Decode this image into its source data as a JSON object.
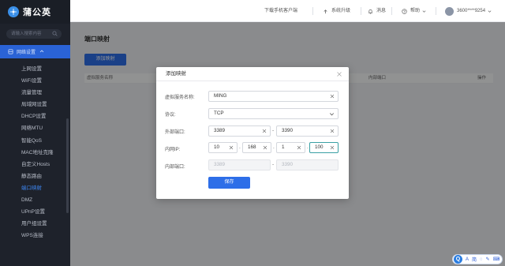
{
  "sidebar": {
    "brand": "蒲公英",
    "search_placeholder": "请输入搜索内容",
    "group_label": "网络设置",
    "items": [
      {
        "label": "上网设置"
      },
      {
        "label": "WiFi设置"
      },
      {
        "label": "流量管理"
      },
      {
        "label": "局域网设置"
      },
      {
        "label": "DHCP设置"
      },
      {
        "label": "网络MTU"
      },
      {
        "label": "智能QoS"
      },
      {
        "label": "MAC地址克隆"
      },
      {
        "label": "自定义Hosts"
      },
      {
        "label": "静态路由"
      },
      {
        "label": "端口映射",
        "active": true
      },
      {
        "label": "DMZ"
      },
      {
        "label": "UPnP设置"
      },
      {
        "label": "用户组设置"
      },
      {
        "label": "WPS连接"
      }
    ]
  },
  "topbar": {
    "download_client": "下载手机客户端",
    "system_upgrade": "系统升级",
    "messages": "消息",
    "help": "帮助",
    "account": "3600****9254"
  },
  "page": {
    "title": "端口映射",
    "add_button": "添加映射",
    "table_headers": {
      "col1": "虚拟服务名称",
      "col2": "内部端口",
      "col3": "操作"
    }
  },
  "modal": {
    "title": "添加映射",
    "fields": {
      "service_name": {
        "label": "虚拟服务名称:",
        "value": "MING"
      },
      "protocol": {
        "label": "协议:",
        "value": "TCP"
      },
      "external_port": {
        "label": "外部端口:",
        "from": "3389",
        "to": "3390",
        "separator": "-"
      },
      "internal_ip": {
        "label": "内网IP:",
        "octets": [
          "10",
          "168",
          "1",
          "100"
        ],
        "separator": "."
      },
      "internal_port": {
        "label": "内部端口:",
        "from": "3389",
        "to": "3390",
        "separator": "-"
      }
    },
    "save_button": "保存"
  },
  "ime": {
    "items": [
      "A",
      "简",
      "◌",
      "✎",
      "⌨"
    ]
  },
  "colors": {
    "sidebar_bg": "#1e222b",
    "accent": "#2d6ee8",
    "focus_border": "#3aa0a4"
  }
}
